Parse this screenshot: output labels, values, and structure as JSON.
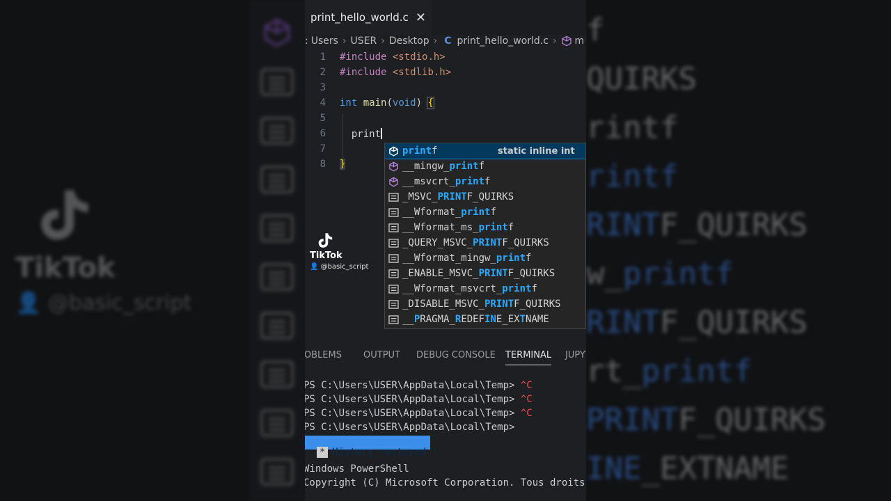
{
  "editor_tab": {
    "filename": "print_hello_world.c",
    "close_glyph": "✕"
  },
  "breadcrumb": {
    "items": [
      ":",
      "Users",
      "USER",
      "Desktop"
    ],
    "file_icon": "C",
    "file": "print_hello_world.c",
    "trail": "m"
  },
  "code_lines": [
    {
      "num": "1",
      "include": "#include",
      "header": "<stdio.h>"
    },
    {
      "num": "2",
      "include": "#include",
      "header": "<stdlib.h>"
    },
    {
      "num": "3"
    },
    {
      "num": "4",
      "type": "int",
      "func": "main",
      "open": "(",
      "param": "void",
      "close": ")",
      "brace": "{"
    },
    {
      "num": "5"
    },
    {
      "num": "6",
      "typed": "print"
    },
    {
      "num": "7"
    },
    {
      "num": "8",
      "brace": "}"
    }
  ],
  "suggestions": [
    {
      "pre": "",
      "match": "print",
      "post": "f",
      "icon": "cube",
      "detail": "static inline int"
    },
    {
      "pre": "__mingw_",
      "match": "print",
      "post": "f",
      "icon": "cube"
    },
    {
      "pre": "__msvcrt_",
      "match": "print",
      "post": "f",
      "icon": "cube"
    },
    {
      "pre": "_MSVC_",
      "match": "PRINT",
      "post": "F_QUIRKS",
      "icon": "macro"
    },
    {
      "pre": "__Wformat_",
      "match": "print",
      "post": "f",
      "icon": "macro"
    },
    {
      "pre": "__Wformat_ms_",
      "match": "print",
      "post": "f",
      "icon": "macro"
    },
    {
      "pre": "_QUERY_MSVC_",
      "match": "PRINT",
      "post": "F_QUIRKS",
      "icon": "macro"
    },
    {
      "pre": "__Wformat_mingw_",
      "match": "print",
      "post": "f",
      "icon": "macro"
    },
    {
      "pre": "_ENABLE_MSVC_",
      "match": "PRINT",
      "post": "F_QUIRKS",
      "icon": "macro"
    },
    {
      "pre": "__Wformat_msvcrt_",
      "match": "print",
      "post": "f",
      "icon": "macro"
    },
    {
      "pre": "_DISABLE_MSVC_",
      "match": "PRINT",
      "post": "F_QUIRKS",
      "icon": "macro"
    },
    {
      "pre": "__",
      "match": "P",
      "mid1": "RAGMA_",
      "match2": "R",
      "mid2": "EDEF",
      "match3": "IN",
      "mid3": "E_EX",
      "match4": "T",
      "post": "NAME",
      "icon": "macro"
    }
  ],
  "panel_tabs": [
    "PROBLEMS",
    "OUTPUT",
    "DEBUG CONSOLE",
    "TERMINAL",
    "JUPYTER"
  ],
  "active_panel_tab": "TERMINAL",
  "terminal": {
    "lines": [
      {
        "prompt": "PS C:\\Users\\USER\\AppData\\Local\\Temp> ",
        "cmd": "^C"
      },
      {
        "prompt": "PS C:\\Users\\USER\\AppData\\Local\\Temp> ",
        "cmd": "^C"
      },
      {
        "prompt": "PS C:\\Users\\USER\\AppData\\Local\\Temp> ",
        "cmd": "^C"
      },
      {
        "prompt": "PS C:\\Users\\USER\\AppData\\Local\\Temp> ",
        "cmd": ""
      }
    ],
    "restored_star": "*",
    "restored": "History restored",
    "shell_name": "Windows PowerShell",
    "copyright": "Copyright (C) Microsoft Corporation. Tous droits r"
  },
  "watermark": {
    "brand": "TikTok",
    "user": "@basic_script"
  },
  "background": {
    "brand": "TikTok",
    "user": "@basic_script",
    "lines": [
      {
        "pre": "",
        "hl": "",
        "post": "f"
      },
      {
        "pre": "",
        "hl": "",
        "post": "QUIRKS"
      },
      {
        "pre": "",
        "hl": "",
        "post": "rintf"
      },
      {
        "pre": "",
        "hl": "rintf",
        "post": ""
      },
      {
        "pre": "",
        "hl": "RINT",
        "post": "F_QUIRKS"
      },
      {
        "pre": "w_",
        "hl": "printf",
        "post": ""
      },
      {
        "pre": "",
        "hl": "RINT",
        "post": "F_QUIRKS"
      },
      {
        "pre": "rt_",
        "hl": "printf",
        "post": ""
      },
      {
        "pre": "",
        "hl": "PRINT",
        "post": "F_QUIRKS"
      },
      {
        "pre": "",
        "hl": "INE",
        "post": "_EXTNAME"
      }
    ]
  },
  "colors": {
    "match": "#2aaaff",
    "selection": "#04395e",
    "keyword": "#569cd6",
    "string": "#ce9178",
    "terminal_error": "#f14c4c"
  }
}
